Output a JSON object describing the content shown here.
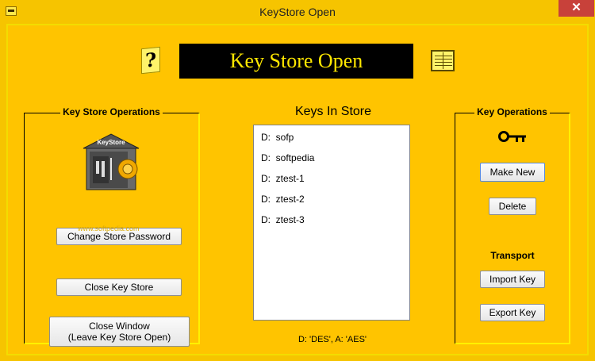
{
  "window": {
    "title": "KeyStore Open",
    "close_glyph": "✕"
  },
  "header": {
    "banner": "Key Store Open",
    "help_glyph": "?"
  },
  "left_group": {
    "label": "Key Store Operations",
    "icon_text": "KeyStore",
    "change_password_label": "Change Store Password",
    "close_store_label": "Close Key Store",
    "close_window_line1": "Close Window",
    "close_window_line2": "(Leave Key Store Open)"
  },
  "watermark": "www.softpedia.com",
  "keys": {
    "title": "Keys In Store",
    "items": [
      {
        "prefix": "D:",
        "name": "sofp"
      },
      {
        "prefix": "D:",
        "name": "softpedia"
      },
      {
        "prefix": "D:",
        "name": "ztest-1"
      },
      {
        "prefix": "D:",
        "name": "ztest-2"
      },
      {
        "prefix": "D:",
        "name": "ztest-3"
      }
    ],
    "legend": "D: 'DES',  A: 'AES'"
  },
  "right_group": {
    "label": "Key Operations",
    "make_new_label": "Make New",
    "delete_label": "Delete",
    "transport_label": "Transport",
    "import_label": "Import Key",
    "export_label": "Export Key"
  }
}
